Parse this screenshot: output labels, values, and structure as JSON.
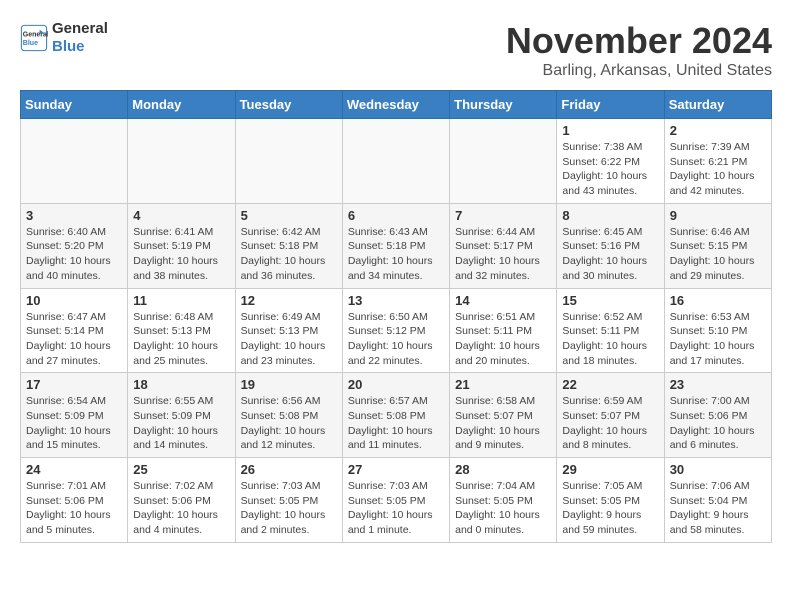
{
  "header": {
    "logo_line1": "General",
    "logo_line2": "Blue",
    "month": "November 2024",
    "location": "Barling, Arkansas, United States"
  },
  "weekdays": [
    "Sunday",
    "Monday",
    "Tuesday",
    "Wednesday",
    "Thursday",
    "Friday",
    "Saturday"
  ],
  "weeks": [
    [
      {
        "day": "",
        "detail": ""
      },
      {
        "day": "",
        "detail": ""
      },
      {
        "day": "",
        "detail": ""
      },
      {
        "day": "",
        "detail": ""
      },
      {
        "day": "",
        "detail": ""
      },
      {
        "day": "1",
        "detail": "Sunrise: 7:38 AM\nSunset: 6:22 PM\nDaylight: 10 hours\nand 43 minutes."
      },
      {
        "day": "2",
        "detail": "Sunrise: 7:39 AM\nSunset: 6:21 PM\nDaylight: 10 hours\nand 42 minutes."
      }
    ],
    [
      {
        "day": "3",
        "detail": "Sunrise: 6:40 AM\nSunset: 5:20 PM\nDaylight: 10 hours\nand 40 minutes."
      },
      {
        "day": "4",
        "detail": "Sunrise: 6:41 AM\nSunset: 5:19 PM\nDaylight: 10 hours\nand 38 minutes."
      },
      {
        "day": "5",
        "detail": "Sunrise: 6:42 AM\nSunset: 5:18 PM\nDaylight: 10 hours\nand 36 minutes."
      },
      {
        "day": "6",
        "detail": "Sunrise: 6:43 AM\nSunset: 5:18 PM\nDaylight: 10 hours\nand 34 minutes."
      },
      {
        "day": "7",
        "detail": "Sunrise: 6:44 AM\nSunset: 5:17 PM\nDaylight: 10 hours\nand 32 minutes."
      },
      {
        "day": "8",
        "detail": "Sunrise: 6:45 AM\nSunset: 5:16 PM\nDaylight: 10 hours\nand 30 minutes."
      },
      {
        "day": "9",
        "detail": "Sunrise: 6:46 AM\nSunset: 5:15 PM\nDaylight: 10 hours\nand 29 minutes."
      }
    ],
    [
      {
        "day": "10",
        "detail": "Sunrise: 6:47 AM\nSunset: 5:14 PM\nDaylight: 10 hours\nand 27 minutes."
      },
      {
        "day": "11",
        "detail": "Sunrise: 6:48 AM\nSunset: 5:13 PM\nDaylight: 10 hours\nand 25 minutes."
      },
      {
        "day": "12",
        "detail": "Sunrise: 6:49 AM\nSunset: 5:13 PM\nDaylight: 10 hours\nand 23 minutes."
      },
      {
        "day": "13",
        "detail": "Sunrise: 6:50 AM\nSunset: 5:12 PM\nDaylight: 10 hours\nand 22 minutes."
      },
      {
        "day": "14",
        "detail": "Sunrise: 6:51 AM\nSunset: 5:11 PM\nDaylight: 10 hours\nand 20 minutes."
      },
      {
        "day": "15",
        "detail": "Sunrise: 6:52 AM\nSunset: 5:11 PM\nDaylight: 10 hours\nand 18 minutes."
      },
      {
        "day": "16",
        "detail": "Sunrise: 6:53 AM\nSunset: 5:10 PM\nDaylight: 10 hours\nand 17 minutes."
      }
    ],
    [
      {
        "day": "17",
        "detail": "Sunrise: 6:54 AM\nSunset: 5:09 PM\nDaylight: 10 hours\nand 15 minutes."
      },
      {
        "day": "18",
        "detail": "Sunrise: 6:55 AM\nSunset: 5:09 PM\nDaylight: 10 hours\nand 14 minutes."
      },
      {
        "day": "19",
        "detail": "Sunrise: 6:56 AM\nSunset: 5:08 PM\nDaylight: 10 hours\nand 12 minutes."
      },
      {
        "day": "20",
        "detail": "Sunrise: 6:57 AM\nSunset: 5:08 PM\nDaylight: 10 hours\nand 11 minutes."
      },
      {
        "day": "21",
        "detail": "Sunrise: 6:58 AM\nSunset: 5:07 PM\nDaylight: 10 hours\nand 9 minutes."
      },
      {
        "day": "22",
        "detail": "Sunrise: 6:59 AM\nSunset: 5:07 PM\nDaylight: 10 hours\nand 8 minutes."
      },
      {
        "day": "23",
        "detail": "Sunrise: 7:00 AM\nSunset: 5:06 PM\nDaylight: 10 hours\nand 6 minutes."
      }
    ],
    [
      {
        "day": "24",
        "detail": "Sunrise: 7:01 AM\nSunset: 5:06 PM\nDaylight: 10 hours\nand 5 minutes."
      },
      {
        "day": "25",
        "detail": "Sunrise: 7:02 AM\nSunset: 5:06 PM\nDaylight: 10 hours\nand 4 minutes."
      },
      {
        "day": "26",
        "detail": "Sunrise: 7:03 AM\nSunset: 5:05 PM\nDaylight: 10 hours\nand 2 minutes."
      },
      {
        "day": "27",
        "detail": "Sunrise: 7:03 AM\nSunset: 5:05 PM\nDaylight: 10 hours\nand 1 minute."
      },
      {
        "day": "28",
        "detail": "Sunrise: 7:04 AM\nSunset: 5:05 PM\nDaylight: 10 hours\nand 0 minutes."
      },
      {
        "day": "29",
        "detail": "Sunrise: 7:05 AM\nSunset: 5:05 PM\nDaylight: 9 hours\nand 59 minutes."
      },
      {
        "day": "30",
        "detail": "Sunrise: 7:06 AM\nSunset: 5:04 PM\nDaylight: 9 hours\nand 58 minutes."
      }
    ]
  ]
}
